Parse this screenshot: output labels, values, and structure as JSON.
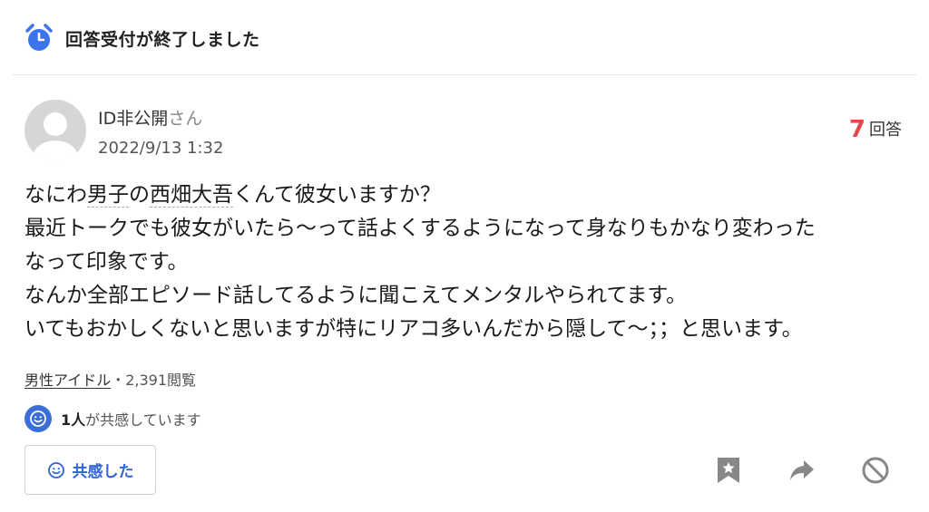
{
  "status": {
    "text": "回答受付が終了しました"
  },
  "question": {
    "user": {
      "name": "ID非公開",
      "suffix": "さん"
    },
    "date": "2022/9/13 1:32",
    "answers": {
      "count": "7",
      "label": "回答"
    },
    "body": {
      "line1": {
        "pre": "なにわ",
        "kw1": "男子",
        "mid": "の",
        "kw2": "西畑大吾",
        "post": "くんて彼女いますか？"
      },
      "line2": "最近トークでも彼女がいたら〜って話よくするようになって身なりもかなり変わった",
      "line3": "なって印象です。",
      "line4": "なんか全部エピソード話してるように聞こえてメンタルやられてます。",
      "line5": "いてもおかしくないと思いますが特にリアコ多いんだから隠して〜；；と思います。"
    },
    "category": "男性アイドル",
    "views": "・2,391閲覧",
    "empathy": {
      "count": "1人",
      "text": "が共感しています"
    },
    "empathy_button": "共感した"
  },
  "icons": {
    "status": "alarm-clock-icon",
    "empathy": "smile-icon",
    "bookmark": "bookmark-icon",
    "share": "share-arrow-icon",
    "block": "block-icon"
  },
  "colors": {
    "accent": "#2f64d4",
    "answer_count": "#e0474f",
    "icon_gray": "#888888"
  }
}
